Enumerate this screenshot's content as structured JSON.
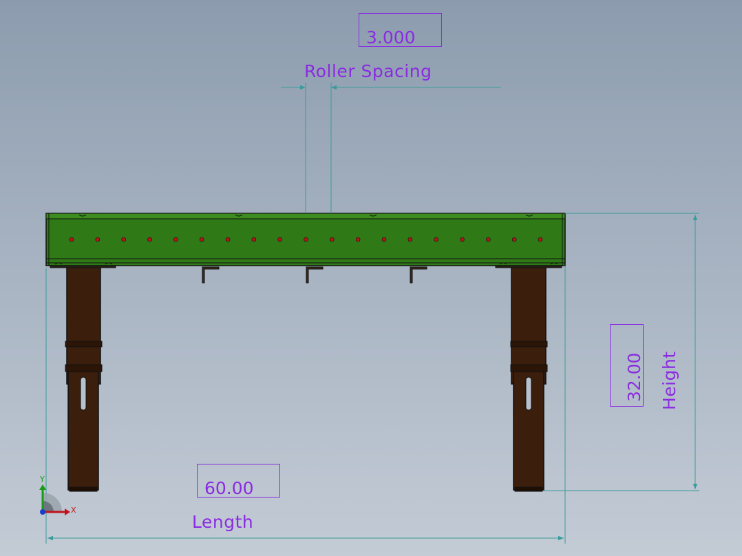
{
  "dimensions": {
    "roller_spacing": {
      "value": "3.000",
      "label": "Roller Spacing"
    },
    "height": {
      "value": "32.00",
      "label": "Height"
    },
    "length": {
      "value": "60.00",
      "label": "Length"
    }
  },
  "triad": {
    "x_label": "X",
    "y_label": "Y"
  },
  "colors": {
    "dimension_text": "#8a2be2",
    "dimension_line": "#3a9b9b",
    "frame": "#2f7a17",
    "legs": "#3b1e0c"
  },
  "drawing": {
    "roller_count": 19
  }
}
